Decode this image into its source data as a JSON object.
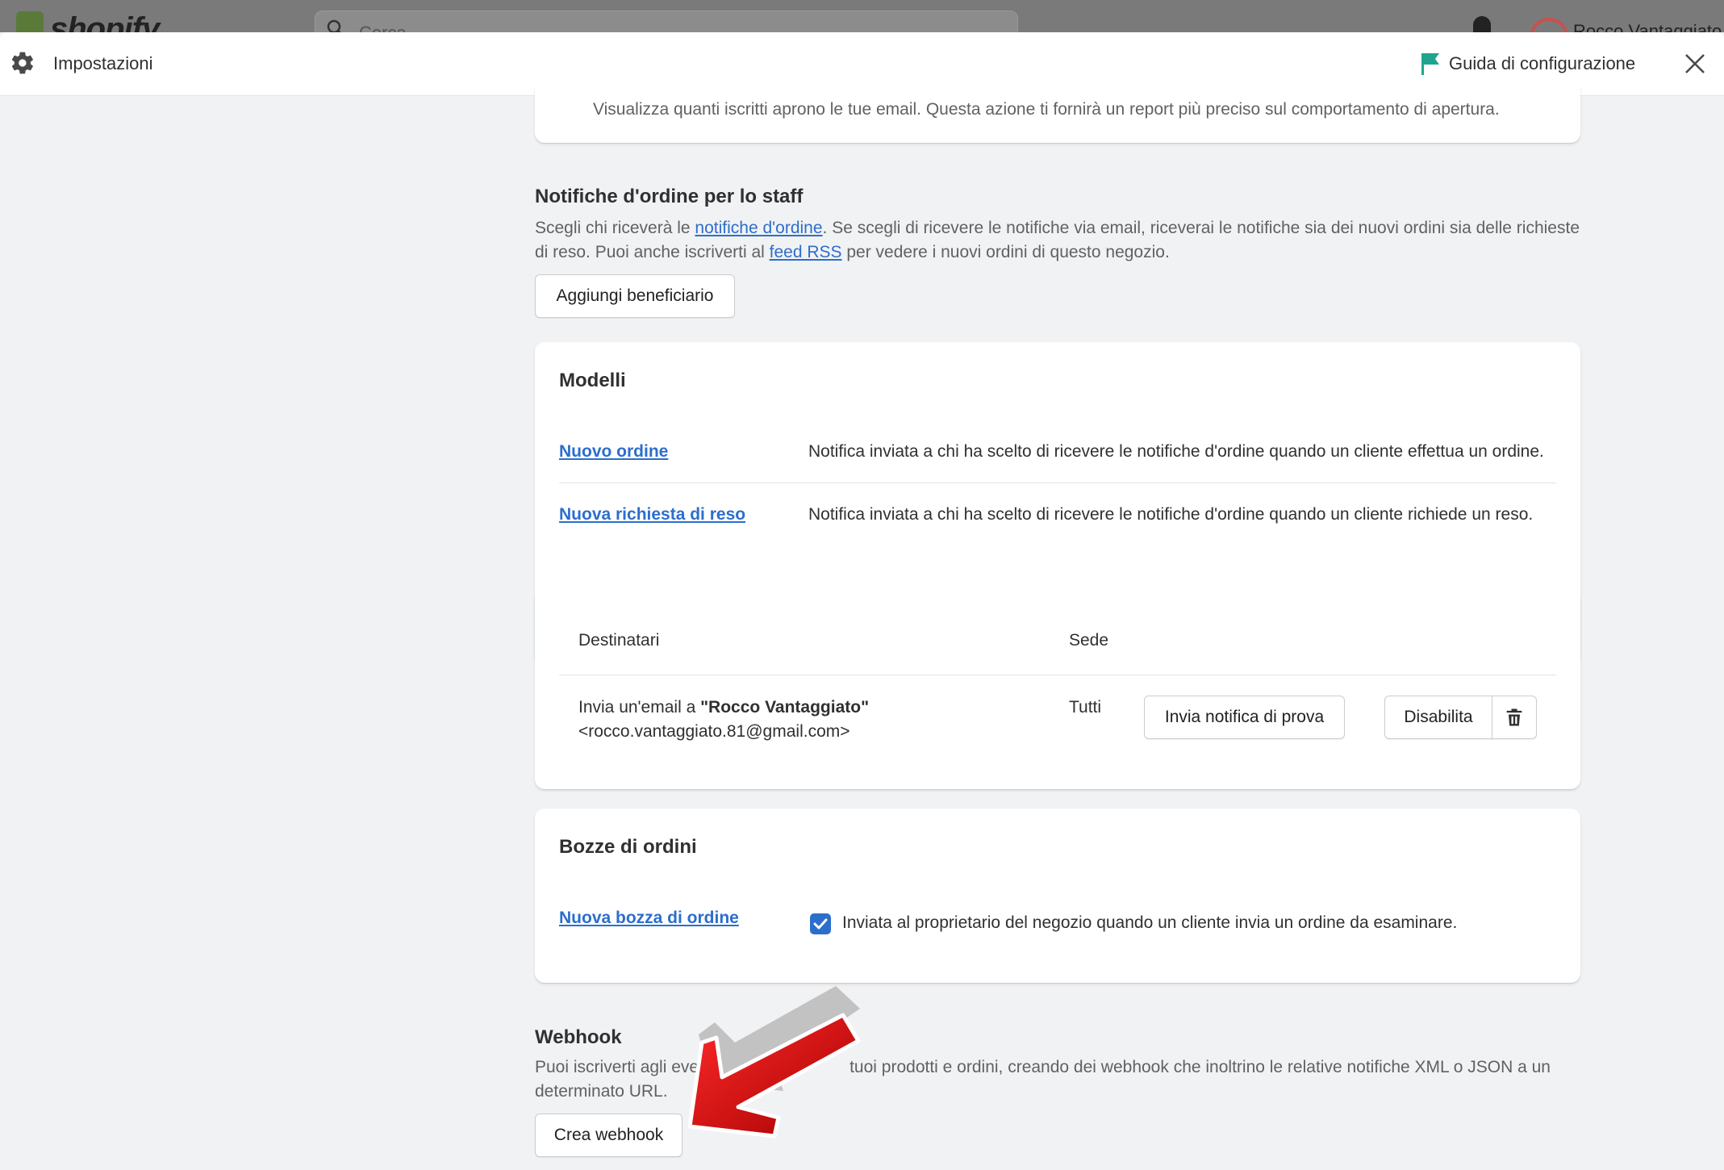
{
  "background": {
    "logo_text": "shopify",
    "search_placeholder": "Cerca",
    "user_name": "Rocco Vantaggiato"
  },
  "header": {
    "title": "Impostazioni",
    "guide_label": "Guida di configurazione"
  },
  "tracking_card": {
    "text": "Visualizza quanti iscritti aprono le tue email. Questa azione ti fornirà un report più preciso sul comportamento di apertura."
  },
  "staff_notifications": {
    "title": "Notifiche d'ordine per lo staff",
    "desc_part1": "Scegli chi riceverà le ",
    "desc_link1": "notifiche d'ordine",
    "desc_part2": ". Se scegli di ricevere le notifiche via email, riceverai le notifiche sia dei nuovi ordini sia delle richieste di reso. Puoi anche iscriverti al ",
    "desc_link2": "feed RSS",
    "desc_part3": " per vedere i nuovi ordini di questo negozio.",
    "add_button": "Aggiungi beneficiario"
  },
  "templates": {
    "title": "Modelli",
    "rows": [
      {
        "link": "Nuovo ordine",
        "desc": "Notifica inviata a chi ha scelto di ricevere le notifiche d'ordine quando un cliente effettua un ordine."
      },
      {
        "link": "Nuova richiesta di reso",
        "desc": "Notifica inviata a chi ha scelto di ricevere le notifiche d'ordine quando un cliente richiede un reso."
      }
    ]
  },
  "recipients": {
    "col_recipients": "Destinatari",
    "col_location": "Sede",
    "row_prefix": "Invia un'email a ",
    "row_name": "\"Rocco Vantaggiato\"",
    "row_email": "<rocco.vantaggiato.81@gmail.com>",
    "row_location": "Tutti",
    "test_button": "Invia notifica di prova",
    "disable_button": "Disabilita"
  },
  "draft_orders": {
    "title": "Bozze di ordini",
    "link": "Nuova bozza di ordine",
    "checked": true,
    "checkbox_label": "Inviata al proprietario del negozio quando un cliente invia un ordine da esaminare."
  },
  "webhook": {
    "title": "Webhook",
    "desc_visible_start": "Puoi iscriverti agli eve",
    "desc_visible_end": "tuoi prodotti e ordini, creando dei webhook che inoltrino le relative notifiche XML o JSON a un",
    "desc_line2": "determinato URL.",
    "create_button": "Crea webhook"
  },
  "colors": {
    "accent": "#2c6ecb",
    "flag": "#1fa58f",
    "arrow": "#d10a0a"
  }
}
